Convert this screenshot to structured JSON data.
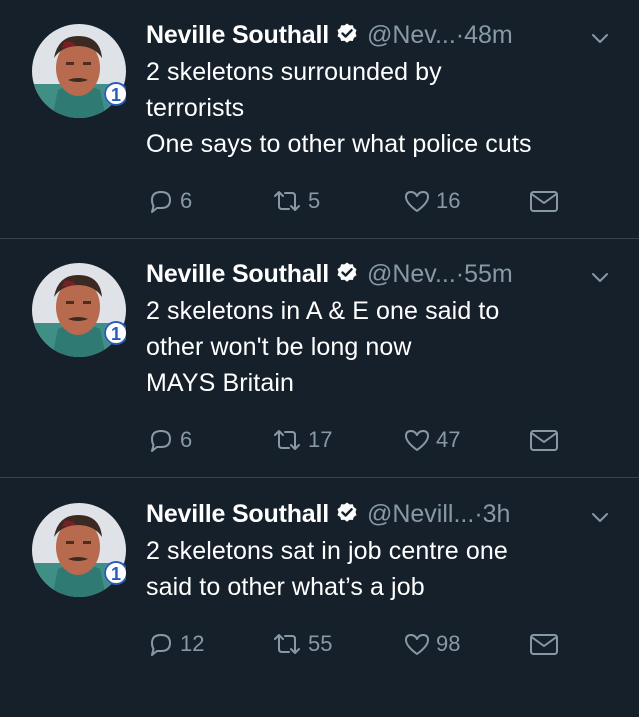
{
  "tweets": [
    {
      "name": "Neville Southall",
      "handle": "@Nev...",
      "dot": "·",
      "time": "48m",
      "lines": [
        "2 skeletons surrounded by",
        "terrorists",
        "One says to other what police cuts"
      ],
      "replies": "6",
      "retweets": "5",
      "likes": "16"
    },
    {
      "name": "Neville Southall",
      "handle": "@Nev...",
      "dot": "·",
      "time": "55m",
      "lines": [
        "2 skeletons in A & E one said to",
        "other won't be long now",
        "MAYS Britain"
      ],
      "replies": "6",
      "retweets": "17",
      "likes": "47"
    },
    {
      "name": "Neville Southall",
      "handle": "@Nevill...",
      "dot": "·",
      "time": "3h",
      "lines": [
        "2 skeletons sat in job centre one",
        "said to other what’s a job"
      ],
      "replies": "12",
      "retweets": "55",
      "likes": "98"
    }
  ],
  "avatar_badge": "1",
  "icons": {
    "verified": "verified-badge-icon",
    "caret": "chevron-down-icon",
    "reply": "reply-icon",
    "retweet": "retweet-icon",
    "like": "heart-icon",
    "dm": "envelope-icon"
  },
  "colors": {
    "background": "#15202b",
    "text": "#ffffff",
    "muted": "#8899a6",
    "divider": "#38444d"
  }
}
